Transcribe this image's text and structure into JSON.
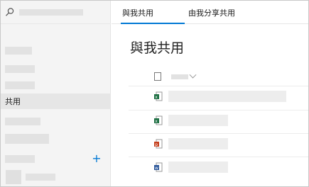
{
  "sidebar": {
    "search_icon": "search-icon",
    "nav_items": [
      {
        "label": ""
      },
      {
        "label": ""
      },
      {
        "label": ""
      },
      {
        "label": "共用",
        "active": true
      },
      {
        "label": ""
      },
      {
        "label": ""
      },
      {
        "label": ""
      }
    ],
    "add_icon": "+"
  },
  "main": {
    "tabs": [
      {
        "label": "與我共用",
        "active": true
      },
      {
        "label": "由我分享共用",
        "active": false
      }
    ],
    "page_title": "與我共用",
    "files": [
      {
        "type": "excel",
        "color": "#1d6f42"
      },
      {
        "type": "excel",
        "color": "#1d6f42"
      },
      {
        "type": "powerpoint",
        "color": "#c43e1c"
      },
      {
        "type": "word",
        "color": "#2b579a"
      }
    ]
  },
  "colors": {
    "accent": "#0078d4",
    "sidebar_bg": "#f4f4f4",
    "placeholder": "#e2e2e2"
  }
}
